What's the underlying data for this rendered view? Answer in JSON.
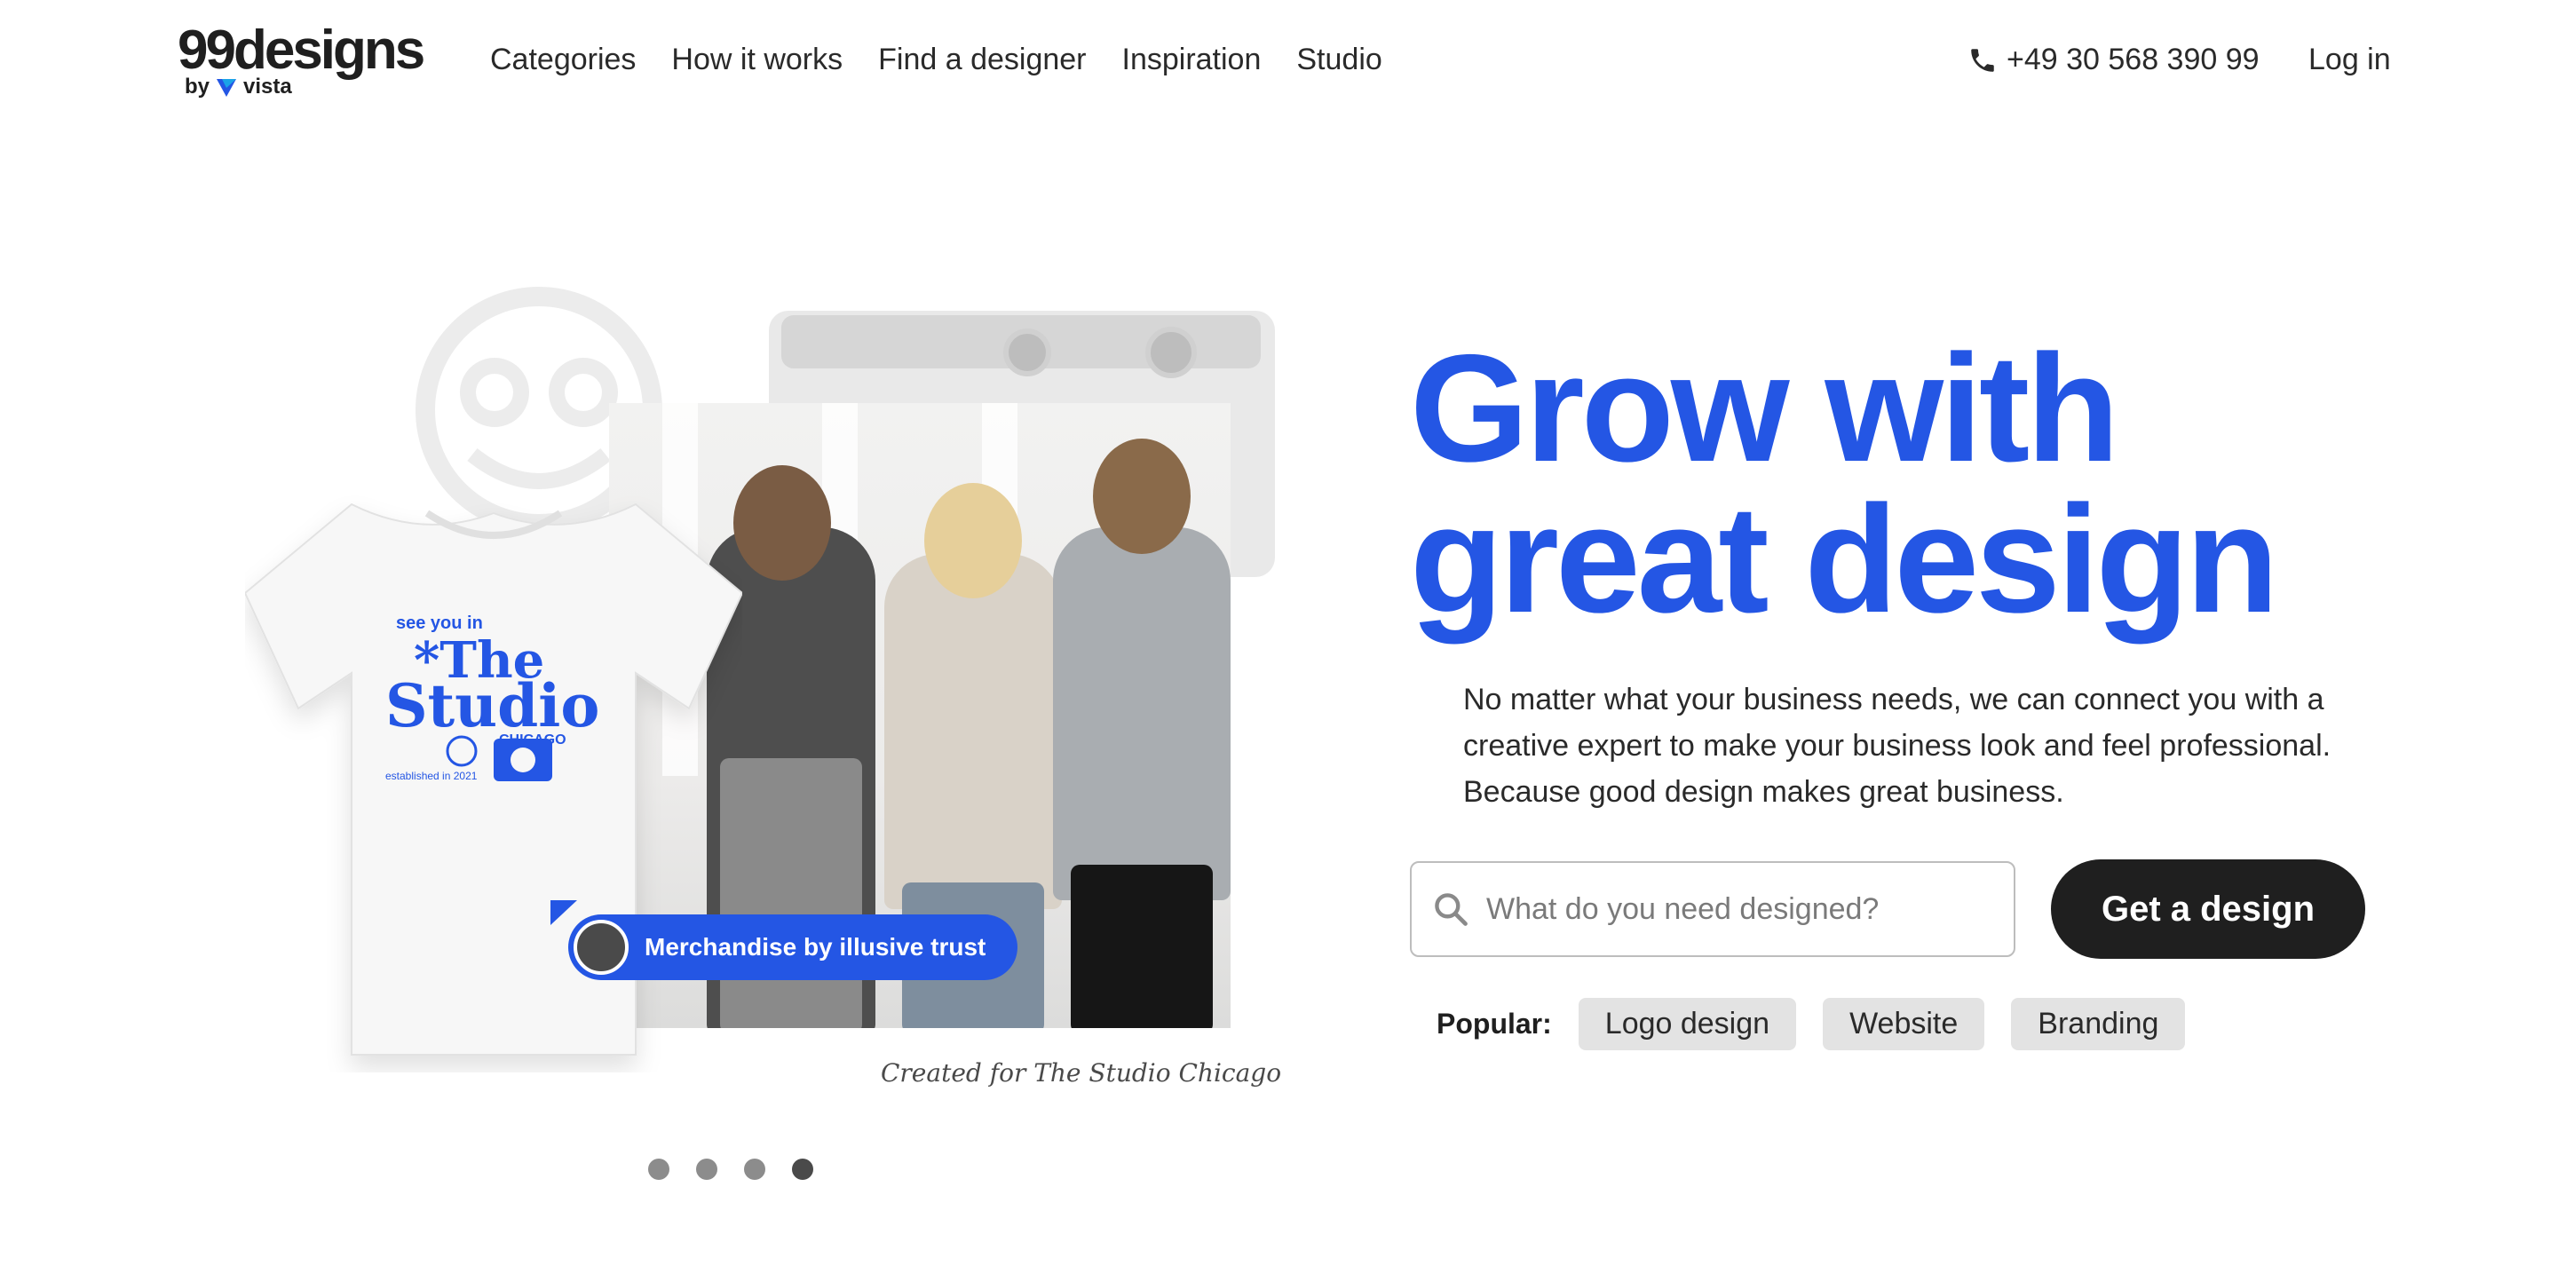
{
  "header": {
    "logo_text": "99designs",
    "logo_sub": "by",
    "logo_brand": "vista",
    "nav": [
      "Categories",
      "How it works",
      "Find a designer",
      "Inspiration",
      "Studio"
    ],
    "phone": "+49 30 568 390 99",
    "login": "Log in"
  },
  "hero": {
    "headline_line1": "Grow with",
    "headline_line2": "great design",
    "subtext": "No matter what your business needs, we can connect you with a creative expert to make your business look and feel professional. Because good design makes great business.",
    "search_placeholder": "What do you need designed?",
    "cta": "Get a design",
    "popular_label": "Popular:",
    "popular_tags": [
      "Logo design",
      "Website",
      "Branding"
    ],
    "badge": "Merchandise by illusive trust",
    "caption": "Created for The Studio Chicago",
    "tshirt_text": {
      "top": "see   you   in",
      "title1": "*The",
      "title2": "Studio",
      "city": "CHICAGO",
      "small": "established in 2021"
    },
    "carousel": {
      "count": 4,
      "active": 4
    }
  },
  "colors": {
    "brand_blue": "#2456e4",
    "dark": "#1f1f1f",
    "tag_bg": "#e3e3e3"
  },
  "icons": [
    "phone-icon",
    "search-icon",
    "vista-logo-icon"
  ]
}
